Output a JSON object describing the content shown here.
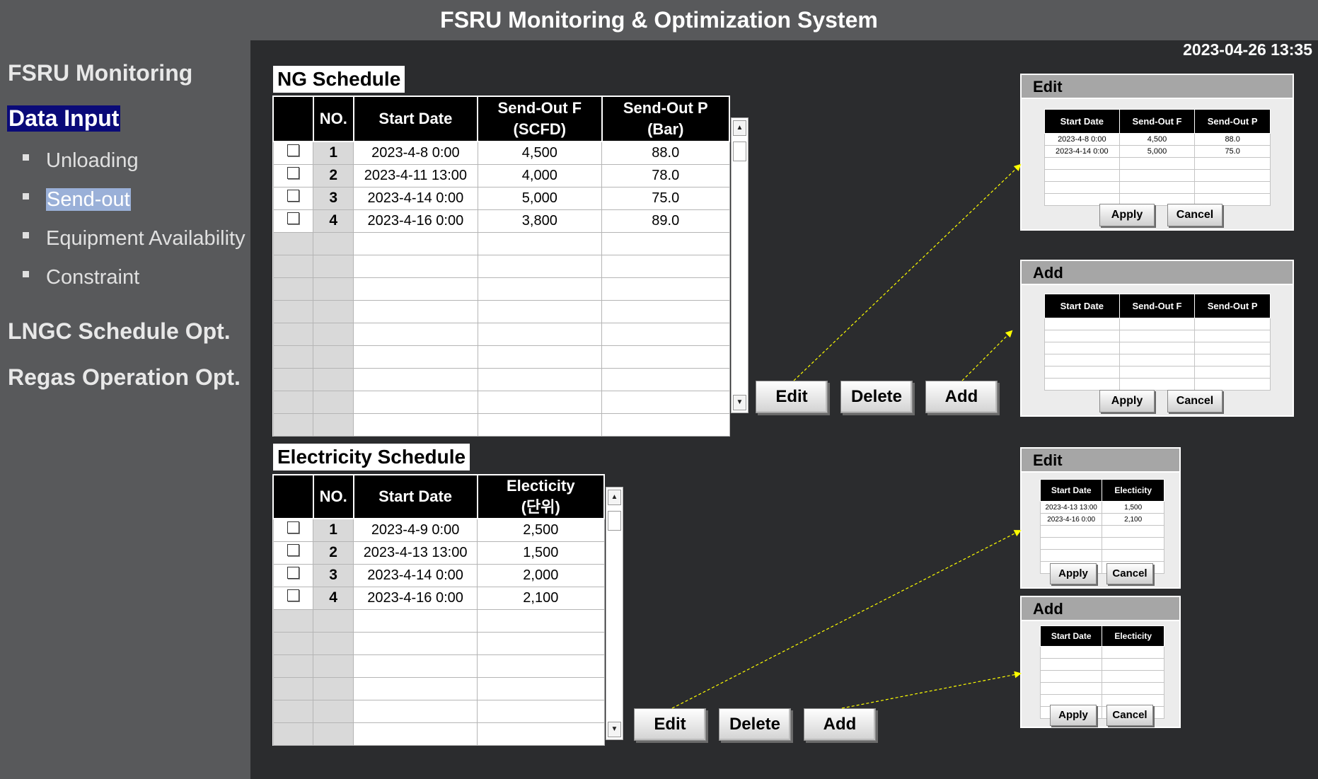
{
  "app": {
    "title": "FSRU Monitoring & Optimization System",
    "datetime": "2023-04-26 13:35"
  },
  "sidebar": {
    "fsru_monitoring": "FSRU Monitoring",
    "data_input": "Data Input",
    "sub_items": [
      "Unloading",
      "Send-out",
      "Equipment Availability",
      "Constraint"
    ],
    "lngc_opt": "LNGC Schedule Opt.",
    "regas_opt": "Regas Operation Opt."
  },
  "ng": {
    "title": "NG Schedule",
    "headers": {
      "no": "NO.",
      "start": "Start Date",
      "sof1": "Send-Out F",
      "sof2": "(SCFD)",
      "sop1": "Send-Out P",
      "sop2": "(Bar)"
    },
    "rows": [
      {
        "no": "1",
        "start": "2023-4-8 0:00",
        "f": "4,500",
        "p": "88.0"
      },
      {
        "no": "2",
        "start": "2023-4-11 13:00",
        "f": "4,000",
        "p": "78.0"
      },
      {
        "no": "3",
        "start": "2023-4-14 0:00",
        "f": "5,000",
        "p": "75.0"
      },
      {
        "no": "4",
        "start": "2023-4-16 0:00",
        "f": "3,800",
        "p": "89.0"
      }
    ],
    "buttons": {
      "edit": "Edit",
      "delete": "Delete",
      "add": "Add"
    }
  },
  "el": {
    "title": "Electricity Schedule",
    "headers": {
      "no": "NO.",
      "start": "Start Date",
      "e1": "Electicity",
      "e2": "(단위)"
    },
    "rows": [
      {
        "no": "1",
        "start": "2023-4-9 0:00",
        "e": "2,500"
      },
      {
        "no": "2",
        "start": "2023-4-13 13:00",
        "e": "1,500"
      },
      {
        "no": "3",
        "start": "2023-4-14 0:00",
        "e": "2,000"
      },
      {
        "no": "4",
        "start": "2023-4-16 0:00",
        "e": "2,100"
      }
    ],
    "buttons": {
      "edit": "Edit",
      "delete": "Delete",
      "add": "Add"
    }
  },
  "ng_edit": {
    "title": "Edit",
    "headers": [
      "Start Date",
      "Send-Out F",
      "Send-Out P"
    ],
    "rows": [
      {
        "start": "2023-4-8 0:00",
        "f": "4,500",
        "p": "88.0"
      },
      {
        "start": "2023-4-14 0:00",
        "f": "5,000",
        "p": "75.0"
      }
    ],
    "apply": "Apply",
    "cancel": "Cancel"
  },
  "ng_add": {
    "title": "Add",
    "headers": [
      "Start Date",
      "Send-Out F",
      "Send-Out P"
    ],
    "apply": "Apply",
    "cancel": "Cancel"
  },
  "el_edit": {
    "title": "Edit",
    "headers": [
      "Start Date",
      "Electicity"
    ],
    "rows": [
      {
        "start": "2023-4-13 13:00",
        "e": "1,500"
      },
      {
        "start": "2023-4-16 0:00",
        "e": "2,100"
      }
    ],
    "apply": "Apply",
    "cancel": "Cancel"
  },
  "el_add": {
    "title": "Add",
    "headers": [
      "Start Date",
      "Electicity"
    ],
    "apply": "Apply",
    "cancel": "Cancel"
  },
  "colors": {
    "accent": "#0a0a78",
    "selected": "#9ab0d8",
    "arrow": "#ffff00"
  }
}
